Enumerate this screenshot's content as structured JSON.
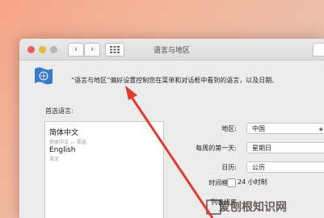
{
  "window": {
    "title": "语言与地区",
    "nav": {
      "back": "‹",
      "forward": "›"
    }
  },
  "description": "“语言与地区”偏好设置控制您在菜单和对话框中看到的语言，以及日期、",
  "preferred": {
    "label": "首选语言:",
    "languages": [
      {
        "name": "简体中文",
        "sub": "简体中文 — 首选"
      },
      {
        "name": "English",
        "sub": "英文"
      }
    ]
  },
  "settings": {
    "region": {
      "label": "地区:",
      "value": "中国"
    },
    "first_day": {
      "label": "每周的第一天:",
      "value": "星期日"
    },
    "calendar": {
      "label": "日历:",
      "value": "公历"
    },
    "time_format": {
      "label": "时间格式:",
      "value": "24 小时制"
    },
    "sort_order": {
      "label": "列表排序"
    }
  },
  "watermark": {
    "text": "爱刨根知识网",
    "color": "#3a2a2a"
  },
  "colors": {
    "arrow": "#e03b2f",
    "close": "#ec5f57",
    "minimize": "#e4bb3f"
  },
  "icons": [
    "flag-icon",
    "grid-icon",
    "chevron-icon",
    "arrow-annotation"
  ]
}
